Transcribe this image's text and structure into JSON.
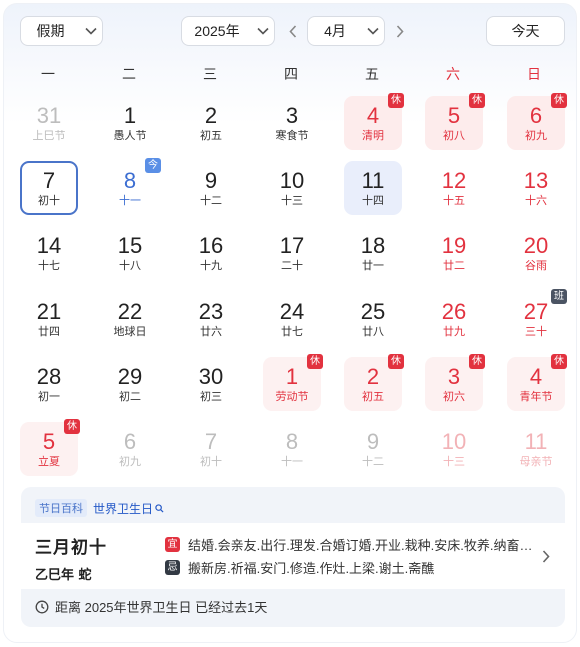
{
  "header": {
    "holiday_select": "假期",
    "year_select": "2025年",
    "month_select": "4月",
    "today_button": "今天"
  },
  "weekdays": [
    "一",
    "二",
    "三",
    "四",
    "五",
    "六",
    "日"
  ],
  "days": [
    {
      "num": "31",
      "lunar": "上巳节",
      "other": true
    },
    {
      "num": "1",
      "lunar": "愚人节"
    },
    {
      "num": "2",
      "lunar": "初五"
    },
    {
      "num": "3",
      "lunar": "寒食节"
    },
    {
      "num": "4",
      "lunar": "清明",
      "holiday": true,
      "badge": "休"
    },
    {
      "num": "5",
      "lunar": "初八",
      "holiday": true,
      "badge": "休"
    },
    {
      "num": "6",
      "lunar": "初九",
      "holiday": true,
      "badge": "休"
    },
    {
      "num": "7",
      "lunar": "初十",
      "selected": true
    },
    {
      "num": "8",
      "lunar": "十一",
      "today": true,
      "badge": "今"
    },
    {
      "num": "9",
      "lunar": "十二"
    },
    {
      "num": "10",
      "lunar": "十三"
    },
    {
      "num": "11",
      "lunar": "十四",
      "hover": true
    },
    {
      "num": "12",
      "lunar": "十五"
    },
    {
      "num": "13",
      "lunar": "十六"
    },
    {
      "num": "14",
      "lunar": "十七"
    },
    {
      "num": "15",
      "lunar": "十八"
    },
    {
      "num": "16",
      "lunar": "十九"
    },
    {
      "num": "17",
      "lunar": "二十"
    },
    {
      "num": "18",
      "lunar": "廿一"
    },
    {
      "num": "19",
      "lunar": "廿二"
    },
    {
      "num": "20",
      "lunar": "谷雨"
    },
    {
      "num": "21",
      "lunar": "廿四"
    },
    {
      "num": "22",
      "lunar": "地球日"
    },
    {
      "num": "23",
      "lunar": "廿六"
    },
    {
      "num": "24",
      "lunar": "廿七"
    },
    {
      "num": "25",
      "lunar": "廿八"
    },
    {
      "num": "26",
      "lunar": "廿九"
    },
    {
      "num": "27",
      "lunar": "三十",
      "badge": "班",
      "workday": true
    },
    {
      "num": "28",
      "lunar": "初一"
    },
    {
      "num": "29",
      "lunar": "初二"
    },
    {
      "num": "30",
      "lunar": "初三"
    },
    {
      "num": "1",
      "lunar": "劳动节",
      "other": true,
      "holiday": true,
      "badge": "休"
    },
    {
      "num": "2",
      "lunar": "初五",
      "other": true,
      "holiday": true,
      "badge": "休"
    },
    {
      "num": "3",
      "lunar": "初六",
      "other": true,
      "holiday": true,
      "badge": "休"
    },
    {
      "num": "4",
      "lunar": "青年节",
      "other": true,
      "holiday": true,
      "badge": "休"
    },
    {
      "num": "5",
      "lunar": "立夏",
      "other": true,
      "holiday": true,
      "badge": "休"
    },
    {
      "num": "6",
      "lunar": "初九",
      "other": true
    },
    {
      "num": "7",
      "lunar": "初十",
      "other": true
    },
    {
      "num": "8",
      "lunar": "十一",
      "other": true
    },
    {
      "num": "9",
      "lunar": "十二",
      "other": true
    },
    {
      "num": "10",
      "lunar": "十三",
      "other": true
    },
    {
      "num": "11",
      "lunar": "母亲节",
      "other": true
    }
  ],
  "info": {
    "tag": "节日百科",
    "festival": "世界卫生日",
    "lunar_date": "三月初十",
    "ganzhi": "乙巳年 蛇",
    "yi_label": "宜",
    "yi_text": "结婚.会亲友.出行.理发.合婚订婚.开业.栽种.安床.牧养.纳畜.入宅",
    "ji_label": "忌",
    "ji_text": "搬新房.祈福.安门.修造.作灶.上梁.谢土.斋醮",
    "countdown": "距离 2025年世界卫生日 已经过去1天"
  },
  "colors": {
    "holiday_red": "#e2323f",
    "holiday_bg": "#fdecec",
    "accent_blue": "#4a74c9",
    "today_blue": "#3c6ed2"
  }
}
